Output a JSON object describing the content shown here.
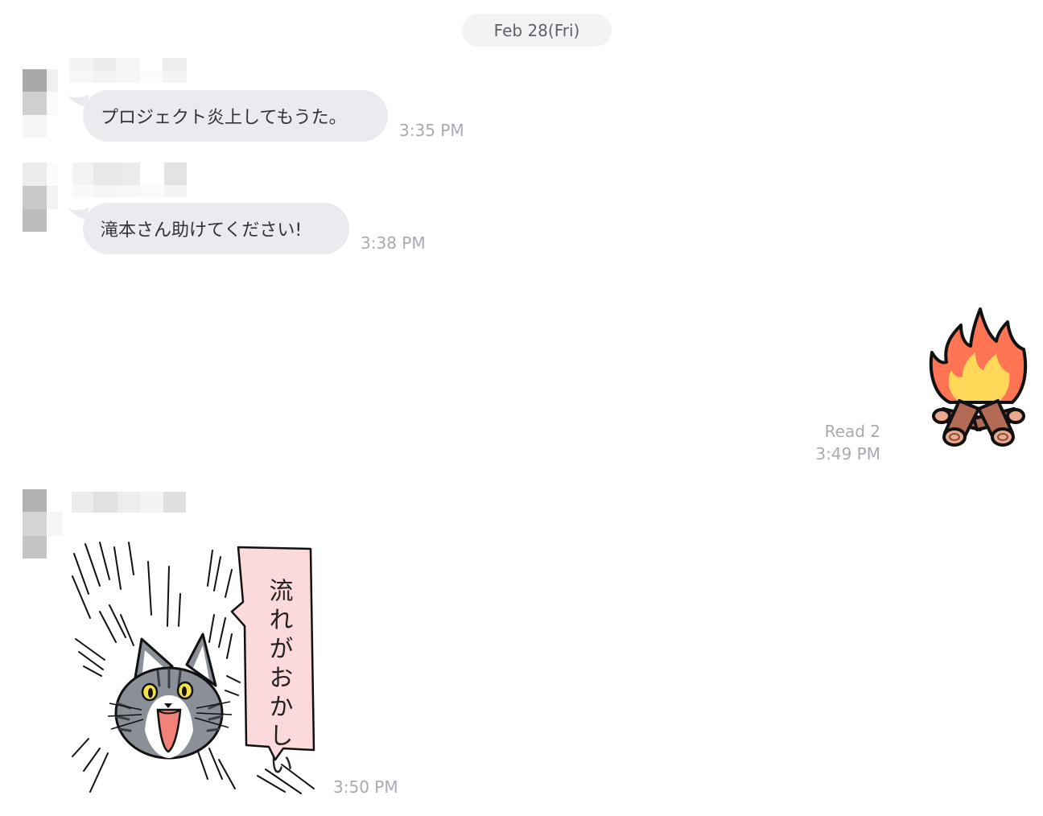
{
  "date_separator": "Feb 28(Fri)",
  "messages": [
    {
      "sender": "other",
      "text": "プロジェクト炎上してもうた。",
      "time": "3:35 PM"
    },
    {
      "sender": "other",
      "text": "滝本さん助けてください!",
      "time": "3:38 PM"
    },
    {
      "sender": "self",
      "type": "sticker",
      "sticker": "campfire-icon",
      "read": "Read 2",
      "time": "3:49 PM"
    },
    {
      "sender": "other",
      "type": "sticker",
      "sticker": "surprised-cat-sticker",
      "sticker_text": "流れがおかしい",
      "time": "3:50 PM"
    }
  ],
  "colors": {
    "bubble": "#e9ebee",
    "meta_text": "#a7abb1",
    "flame_outer": "#ff7452",
    "flame_inner": "#ffd85a",
    "logs": "#b36b55",
    "speech_panel": "#fcd9da"
  }
}
